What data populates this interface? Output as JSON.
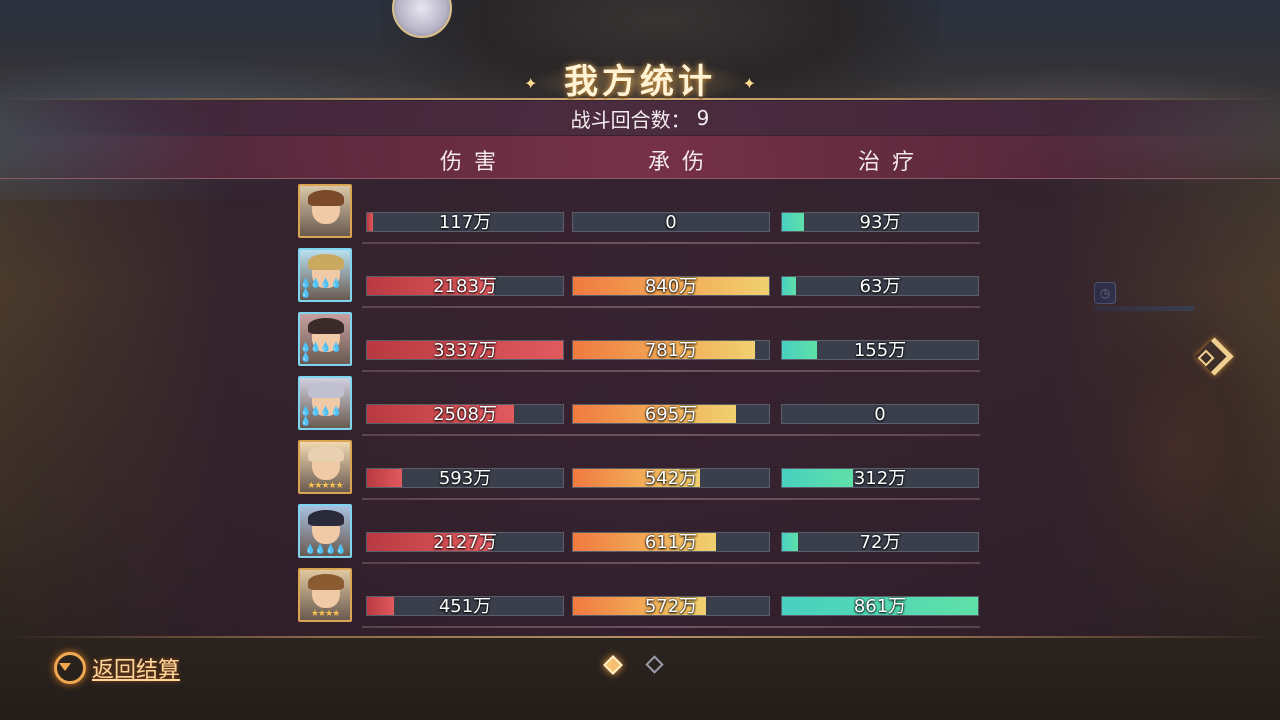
{
  "title": "我方统计",
  "rounds": {
    "label": "战斗回合数：",
    "value": "9"
  },
  "headers": {
    "damage": "伤害",
    "taken": "承伤",
    "heal": "治疗"
  },
  "rows": [
    {
      "damage": "117万",
      "damage_fill": 0.03,
      "taken": "0",
      "taken_fill": 0.0,
      "heal": "93万",
      "heal_fill": 0.11,
      "frame": "gold",
      "stars": ""
    },
    {
      "damage": "2183万",
      "damage_fill": 0.65,
      "taken": "840万",
      "taken_fill": 1.0,
      "heal": "63万",
      "heal_fill": 0.07,
      "frame": "blue",
      "stars": "💧💧💧💧💧"
    },
    {
      "damage": "3337万",
      "damage_fill": 1.0,
      "taken": "781万",
      "taken_fill": 0.93,
      "heal": "155万",
      "heal_fill": 0.18,
      "frame": "blue",
      "stars": "💧💧💧💧💧"
    },
    {
      "damage": "2508万",
      "damage_fill": 0.75,
      "taken": "695万",
      "taken_fill": 0.83,
      "heal": "0",
      "heal_fill": 0.0,
      "frame": "blue",
      "stars": "💧💧💧💧💧"
    },
    {
      "damage": "593万",
      "damage_fill": 0.18,
      "taken": "542万",
      "taken_fill": 0.65,
      "heal": "312万",
      "heal_fill": 0.36,
      "frame": "gold",
      "stars": "★★★★★"
    },
    {
      "damage": "2127万",
      "damage_fill": 0.64,
      "taken": "611万",
      "taken_fill": 0.73,
      "heal": "72万",
      "heal_fill": 0.08,
      "frame": "blue",
      "stars": "💧💧💧💧"
    },
    {
      "damage": "451万",
      "damage_fill": 0.14,
      "taken": "572万",
      "taken_fill": 0.68,
      "heal": "861万",
      "heal_fill": 1.0,
      "frame": "gold",
      "stars": "★★★★"
    }
  ],
  "back_button": {
    "label": "返回结算"
  },
  "pager": {
    "pages": 2,
    "current": 1
  },
  "colors": {
    "damage": "#e05a5e",
    "taken": "#f2b05a",
    "heal": "#5fe0a8",
    "gold_frame": "#d9a550",
    "blue_frame": "#7fd4f0"
  },
  "icons": {
    "back": "return-arrow-icon",
    "next": "chevron-right-icon"
  }
}
